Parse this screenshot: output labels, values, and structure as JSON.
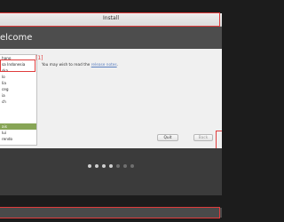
{
  "window": {
    "title": "Install"
  },
  "header": {
    "title": "elcome"
  },
  "languages": [
    {
      "label": "hano"
    },
    {
      "label": "sa Indonesia"
    },
    {
      "label": "ska"
    },
    {
      "label": "lo"
    },
    {
      "label": "lia"
    },
    {
      "label": "ceg"
    },
    {
      "label": "ia"
    },
    {
      "label": "ch"
    },
    {
      "label": ""
    },
    {
      "label": ""
    },
    {
      "label": ""
    },
    {
      "label": "ais"
    },
    {
      "label": "lui"
    },
    {
      "label": "rendo"
    }
  ],
  "selected_language_index": 11,
  "release_notes": {
    "prefix": "You may wish to read the ",
    "link": "release notes",
    "suffix": "."
  },
  "annotation": {
    "label": "[1]",
    "color": "#e03c3c"
  },
  "buttons": {
    "quit": "Quit",
    "back": "Back"
  },
  "progress": {
    "total_steps": 7,
    "completed_steps": 4
  },
  "colors": {
    "header_bg": "#4d4d4d",
    "selection": "#87a556",
    "annotation": "#e03c3c"
  }
}
